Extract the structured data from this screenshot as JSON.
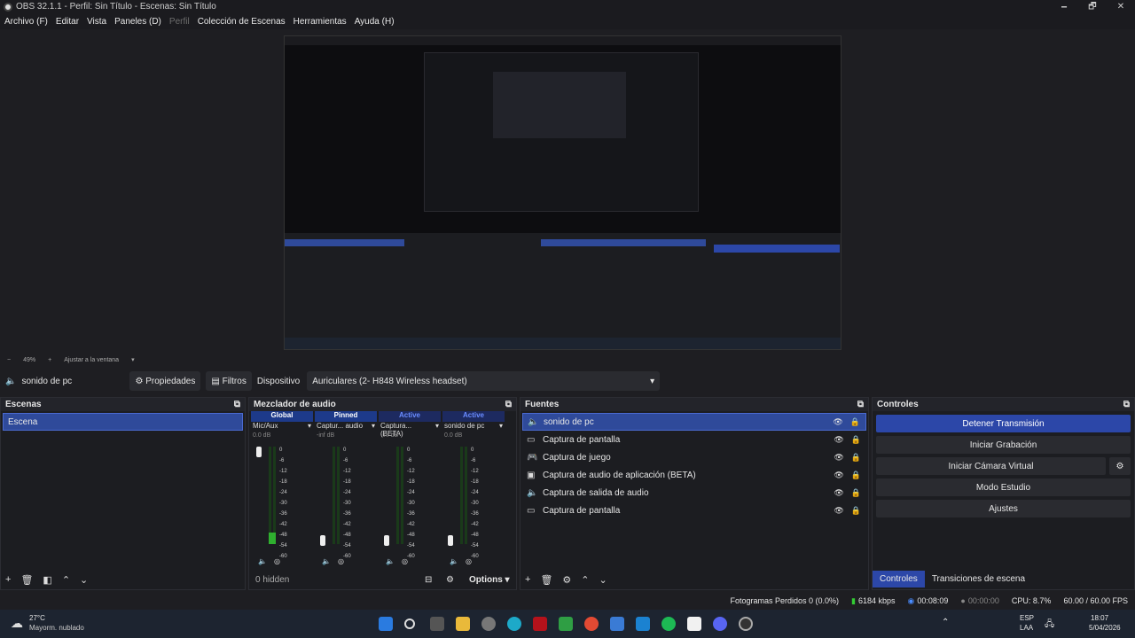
{
  "window": {
    "title": "OBS 32.1.1 - Perfil: Sin Título - Escenas: Sin Título",
    "minimize": "🗕",
    "maximize": "🗗",
    "close": "✕"
  },
  "menu": [
    "Archivo (F)",
    "Editar",
    "Vista",
    "Paneles (D)",
    "Perfil",
    "Colección de Escenas",
    "Herramientas",
    "Ayuda (H)"
  ],
  "zoom": {
    "minus": "−",
    "value": "49%",
    "plus": "+",
    "fit": "Ajustar a la ventana"
  },
  "props": {
    "source_name": "sonido de pc",
    "propiedades": "Propiedades",
    "filtros": "Filtros",
    "dispositivo_label": "Dispositivo",
    "dispositivo_value": "Auriculares (2- H848 Wireless headset)"
  },
  "scenes": {
    "title": "Escenas",
    "items": [
      "Escena"
    ]
  },
  "mixer": {
    "title": "Mezclador de audio",
    "hidden": "0 hidden",
    "options": "Options",
    "channels": [
      {
        "status": "Global",
        "name": "Mic/Aux",
        "db": "0.0 dB",
        "level": 0.12
      },
      {
        "status": "Pinned",
        "name": "Captur... audio",
        "db": "-inf dB",
        "level": 0.0
      },
      {
        "status": "Active",
        "name": "Captura... (BETA)",
        "db": "-inf dB",
        "level": 0.0
      },
      {
        "status": "Active",
        "name": "sonido de pc",
        "db": "0.0 dB",
        "level": 0.0
      }
    ],
    "scale": [
      "0",
      "-6",
      "-12",
      "-18",
      "-24",
      "-30",
      "-36",
      "-42",
      "-48",
      "-54",
      "-60"
    ]
  },
  "sources": {
    "title": "Fuentes",
    "items": [
      {
        "name": "sonido de pc",
        "icon": "speaker-icon"
      },
      {
        "name": "Captura de pantalla",
        "icon": "monitor-icon"
      },
      {
        "name": "Captura de juego",
        "icon": "gamepad-icon"
      },
      {
        "name": "Captura de audio de aplicación (BETA)",
        "icon": "app-audio-icon"
      },
      {
        "name": "Captura de salida de audio",
        "icon": "speaker-icon"
      },
      {
        "name": "Captura de pantalla",
        "icon": "monitor-icon"
      }
    ]
  },
  "controls": {
    "title": "Controles",
    "buttons": [
      "Detener Transmisión",
      "Iniciar Grabación",
      "Iniciar Cámara Virtual",
      "Modo Estudio",
      "Ajustes"
    ],
    "tabs": [
      "Controles",
      "Transiciones de escena"
    ]
  },
  "status": {
    "dropped": "Fotogramas Perdidos 0 (0.0%)",
    "kbps": "6184 kbps",
    "stream_time": "00:08:09",
    "rec_time": "00:00:00",
    "cpu": "CPU: 8.7%",
    "fps": "60.00 / 60.00 FPS"
  },
  "taskbar": {
    "temp": "27°C",
    "weather": "Mayorm. nublado",
    "lang1": "ESP",
    "lang2": "LAA",
    "time": "18:07",
    "date": "5/04/2026"
  },
  "colors": {
    "accent": "#2c47a8",
    "bg": "#1e1e22"
  }
}
